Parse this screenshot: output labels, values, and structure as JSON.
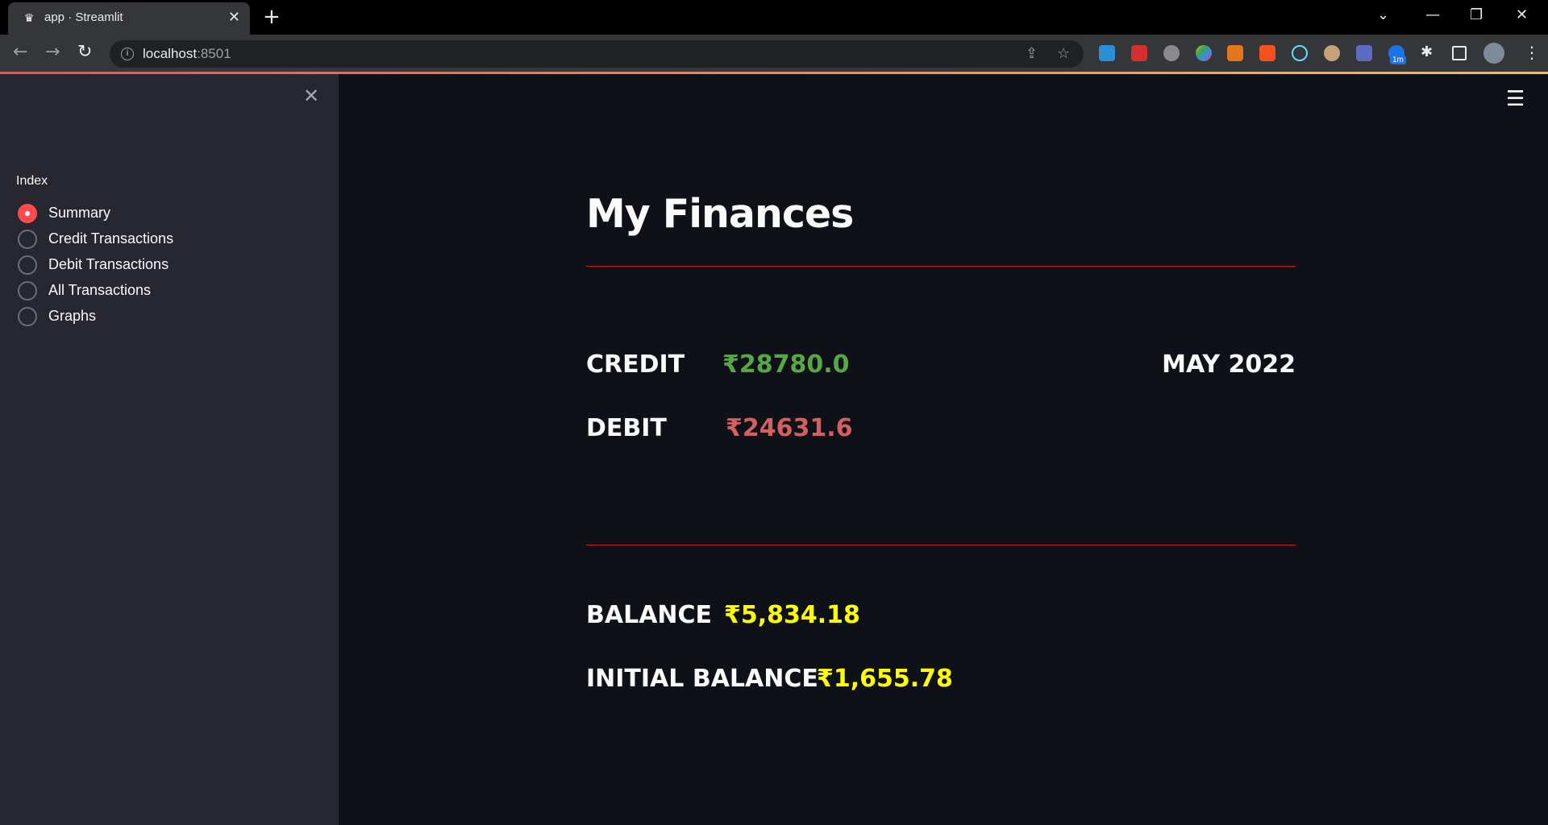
{
  "browser": {
    "tab_title": "app · Streamlit",
    "url_host": "localhost",
    "url_port": ":8501",
    "extension_badge": "1m"
  },
  "sidebar": {
    "radio_label": "Index",
    "options": [
      {
        "label": "Summary",
        "selected": true
      },
      {
        "label": "Credit Transactions",
        "selected": false
      },
      {
        "label": "Debit Transactions",
        "selected": false
      },
      {
        "label": "All Transactions",
        "selected": false
      },
      {
        "label": "Graphs",
        "selected": false
      }
    ]
  },
  "main": {
    "title": "My Finances",
    "month": "MAY 2022",
    "credit": {
      "label": "CREDIT",
      "value": "₹28780.0",
      "color": "#57a845"
    },
    "debit": {
      "label": "DEBIT",
      "value": "₹24631.6",
      "color": "#d35f5f"
    },
    "balance": {
      "label": "BALANCE",
      "value": "₹5,834.18",
      "color": "#ffff00"
    },
    "initial_balance": {
      "label": "INITIAL BALANCE",
      "value": "₹1,655.78",
      "color": "#ffff00"
    }
  },
  "colors": {
    "accent": "#ff4b4b",
    "divider": "#c51c1c",
    "sidebar_bg": "#262730",
    "main_bg": "#0e1117"
  }
}
